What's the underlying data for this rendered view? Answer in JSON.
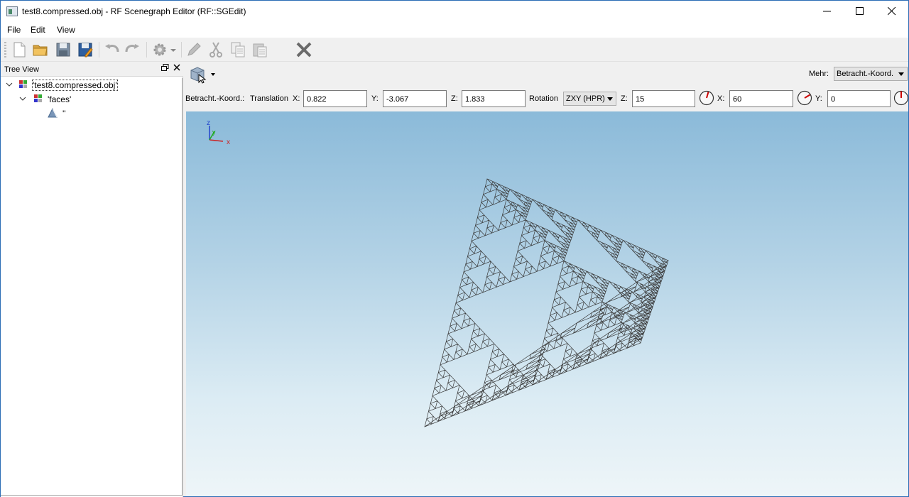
{
  "window": {
    "title": "test8.compressed.obj - RF Scenegraph Editor (RF::SGEdit)",
    "controls": {
      "minimize": "minimize-icon",
      "maximize": "maximize-icon",
      "close": "close-icon"
    }
  },
  "menu": {
    "file": "File",
    "edit": "Edit",
    "view": "View"
  },
  "toolbar": {
    "icons": [
      "new-file-icon",
      "open-folder-icon",
      "save-icon",
      "save-as-icon",
      "undo-icon",
      "redo-icon",
      "settings-gear-icon",
      "edit-pencil-icon",
      "cut-scissors-icon",
      "copy-icon",
      "paste-icon",
      "delete-x-icon"
    ]
  },
  "tree": {
    "header": "Tree View",
    "items": [
      {
        "label": "'test8.compressed.obj'",
        "expanded": true
      },
      {
        "label": "'faces'",
        "expanded": true
      },
      {
        "label": "''"
      }
    ]
  },
  "viewbar": {
    "mehr_label": "Mehr:",
    "mehr_value": "Betracht.-Koord."
  },
  "coords": {
    "system_label": "Betracht.-Koord.:",
    "translation_label": "Translation",
    "x_label": "X:",
    "x_value": "0.822",
    "y_label": "Y:",
    "y_value": "-3.067",
    "z_label": "Z:",
    "z_value": "1.833",
    "rotation_label": "Rotation",
    "rotation_order": "ZXY (HPR)",
    "rz_label": "Z:",
    "rz_value": "15",
    "rx_label": "X:",
    "rx_value": "60",
    "ry_label": "Y:",
    "ry_value": "0"
  },
  "viewport": {
    "axis_labels": {
      "x": "x",
      "y": "y",
      "z": "z"
    },
    "colors": {
      "bg_top": "#8bbad9",
      "bg_bottom": "#eef5f8",
      "mesh": "#3a3a3a",
      "axis_x": "#cc2222",
      "axis_y": "#22aa22",
      "axis_z": "#2244cc"
    }
  }
}
